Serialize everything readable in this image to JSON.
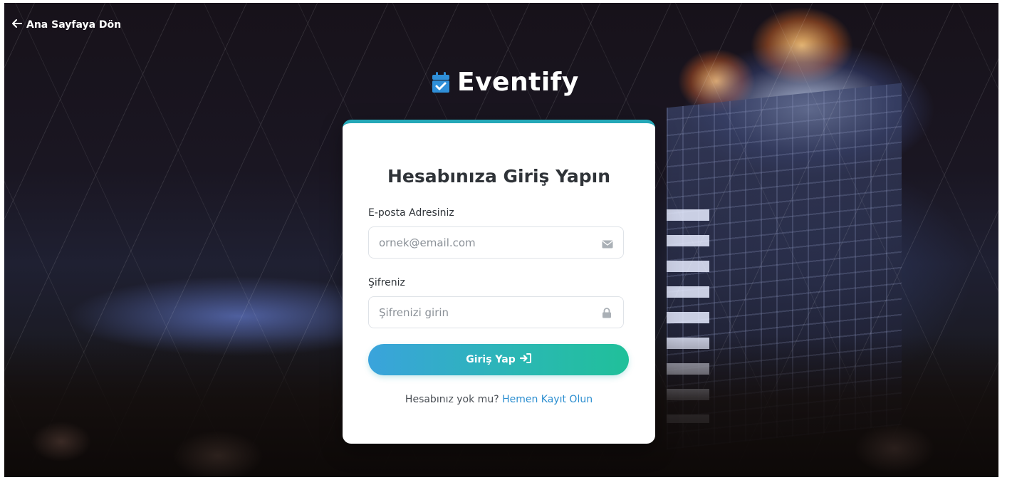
{
  "nav": {
    "back_label": "Ana Sayfaya Dön"
  },
  "brand": {
    "name": "Eventify",
    "icon": "calendar-check-icon",
    "icon_color": "#2f8fd8"
  },
  "login": {
    "title": "Hesabınıza Giriş Yapın",
    "email": {
      "label": "E-posta Adresiniz",
      "placeholder": "ornek@email.com",
      "value": "",
      "icon": "envelope-icon"
    },
    "password": {
      "label": "Şifreniz",
      "placeholder": "Şifrenizi girin",
      "value": "",
      "icon": "lock-icon"
    },
    "submit_label": "Giriş Yap",
    "submit_icon": "sign-in-icon",
    "register_prompt": "Hesabınız yok mu?",
    "register_link": "Hemen Kayıt Olun"
  },
  "colors": {
    "accent_start": "#3aa3dc",
    "accent_end": "#20c09a",
    "link": "#2b8ed0",
    "card_top_border": "#25a8b8"
  }
}
